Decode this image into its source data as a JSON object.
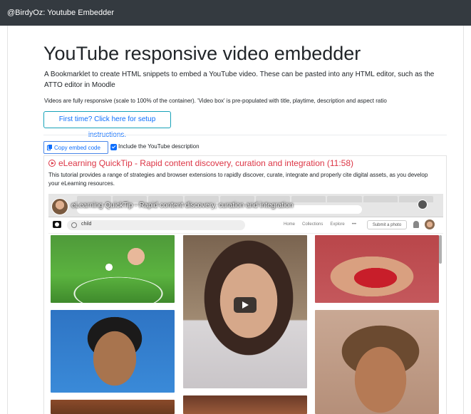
{
  "topbar": {
    "title": "@BirdyOz: Youtube Embedder"
  },
  "page": {
    "heading": "YouTube responsive video embedder",
    "intro": "A Bookmarklet to create HTML snippets to embed a YouTube video. These can be pasted into any HTML editor, such as the ATTO editor in Moodle",
    "note": "Videos are fully responsive (scale to 100% of the container). 'Video box' is pre-populated with title, playtime, description and aspect ratio",
    "setup_button": "First time? Click here for setup instructions."
  },
  "controls": {
    "copy_button": "Copy embed code",
    "include_description_label": "Include the YouTube description",
    "include_description_checked": true
  },
  "video": {
    "title": "eLearning QuickTip - Rapid content discovery, curation and integration (11:58)",
    "description": "This tutorial provides a range of strategies and browser extensions to rapidly discover, curate, integrate and properly cite digital assets, as you develop your eLearning resources.",
    "player_title": "eLearning QuickTip - Rapid content discovery, curation and integration",
    "search_query": "child",
    "site_nav": [
      "Home",
      "Collections",
      "Explore",
      "•••"
    ],
    "submit_button": "Submit a photo"
  },
  "colors": {
    "topbar": "#343a40",
    "accent": "#0d6efd",
    "video_title": "#dc3545",
    "setup_border": "#17a2b8"
  }
}
